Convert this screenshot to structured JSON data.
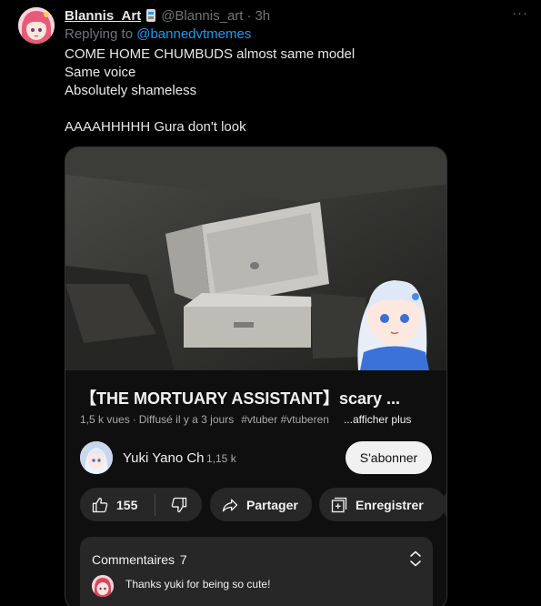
{
  "tweet": {
    "display_name": "Blannis_Art",
    "handle": "@Blannis_art",
    "separator": "·",
    "time": "3h",
    "more_label": "···",
    "replying_prefix": "Replying to",
    "replying_to": "@bannedvtmemes",
    "lines": [
      "COME HOME CHUMBUDS almost same model",
      "Same voice",
      "Absolutely shameless",
      "",
      "AAAAHHHHH Gura don't look"
    ]
  },
  "video": {
    "title": "【THE MORTUARY ASSISTANT】scary ...",
    "views": "1,5 k vues",
    "dot": "·",
    "posted": "Diffusé il y a 3 jours",
    "tags": "#vtuber #vtuberen",
    "show_more": "...afficher plus",
    "channel_name": "Yuki Yano Ch",
    "subscribers": "1,15 k",
    "subscribe_label": "S'abonner",
    "like_count": "155",
    "share_label": "Partager",
    "save_label": "Enregistrer",
    "comments_label": "Commentaires",
    "comments_count": "7",
    "top_comment": "Thanks yuki for being so cute!"
  },
  "colors": {
    "background": "#000000",
    "link": "#1d9bf0",
    "muted": "#71767b",
    "card_bg": "#0f0f0f",
    "pill_bg": "#272727",
    "subscribe_bg": "#f1f1f1"
  },
  "icons": [
    "more-icon",
    "verified-badge-icon",
    "thumbs-up-icon",
    "thumbs-down-icon",
    "share-icon",
    "save-playlist-icon",
    "expand-icon"
  ]
}
